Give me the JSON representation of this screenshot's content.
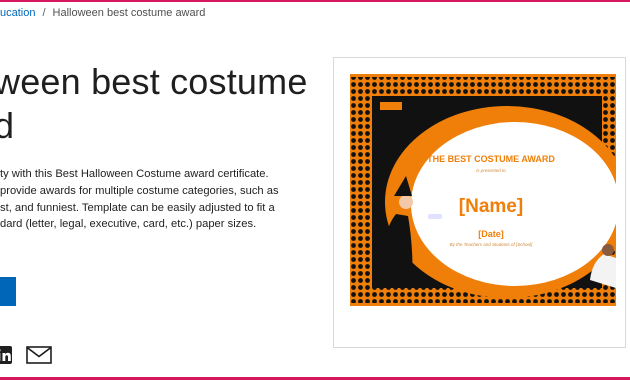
{
  "breadcrumb": {
    "parent": "ucation",
    "separator": "/",
    "current": "Halloween best costume award"
  },
  "page": {
    "title": "ween best costume d",
    "title_line1": "ween best costume",
    "title_line2": "d",
    "description_lines": [
      "ty with this Best Halloween Costume award certificate.",
      "provide awards for multiple costume categories, such as",
      "st, and funniest. Template can be easily adjusted to fit a",
      "dard (letter, legal, executive, card, etc.) paper sizes."
    ]
  },
  "share": {
    "icons": [
      "linkedin-icon",
      "mail-icon"
    ]
  },
  "certificate": {
    "heading": "THE BEST COSTUME AWARD",
    "presented_to": "is presented to",
    "name_placeholder": "[Name]",
    "date_placeholder": "[Date]",
    "presented_by": "By the Teachers and Students of [School]"
  },
  "colors": {
    "accent_link": "#0067b8",
    "button": "#0067b8",
    "frame": "#d6195e",
    "certificate_orange": "#f07f09",
    "certificate_black": "#111111"
  }
}
